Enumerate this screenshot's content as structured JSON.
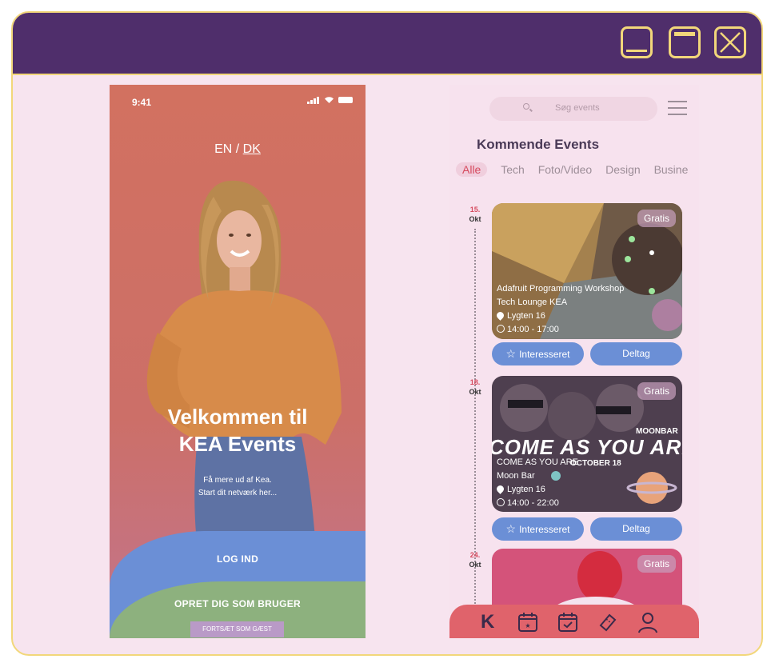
{
  "window": {
    "controls": [
      "minimize",
      "maximize",
      "close"
    ]
  },
  "left_phone": {
    "time": "9:41",
    "lang_en": "EN",
    "lang_sep": "/",
    "lang_dk": "DK",
    "welcome_line1": "Velkommen til",
    "welcome_line2": "KEA Events",
    "sub_line1": "Få mere ud af Kea.",
    "sub_line2": "Start dit netværk her...",
    "login_label": "LOG IND",
    "register_label": "OPRET DIG SOM BRUGER",
    "guest_label": "FORTSÆT SOM GÆST"
  },
  "right_phone": {
    "search_placeholder": "Søg events",
    "heading": "Kommende Events",
    "categories": [
      "Alle",
      "Tech",
      "Foto/Video",
      "Design",
      "Busine"
    ],
    "active_category": "Alle",
    "events": [
      {
        "day": "15.",
        "month": "Okt",
        "badge": "Gratis",
        "title": "Adafruit Programming Workshop",
        "place": "Tech Lounge KEA",
        "address": "Lygten 16",
        "time": "14:00 - 17:00",
        "interested_label": "Interesseret",
        "join_label": "Deltag"
      },
      {
        "day": "18.",
        "month": "Okt",
        "badge": "Gratis",
        "banner": "COME AS YOU ARE",
        "banner_small": "MOONBAR",
        "banner_date": "OCTOBER 18",
        "title": "COME AS YOU ARE",
        "place": "Moon Bar",
        "address": "Lygten 16",
        "time": "14:00 - 22:00",
        "interested_label": "Interesseret",
        "join_label": "Deltag"
      },
      {
        "day": "24.",
        "month": "Okt",
        "badge": "Gratis"
      }
    ],
    "nav_items": [
      "kea-logo",
      "calendar-star",
      "calendar-check",
      "ticket",
      "profile"
    ],
    "nav_logo": "K"
  },
  "colors": {
    "titlebar": "#4f2e6b",
    "accent_gold": "#f2d77a",
    "primary_blue": "#6b8fd6",
    "red": "#e0636b",
    "green": "#8db17e"
  }
}
